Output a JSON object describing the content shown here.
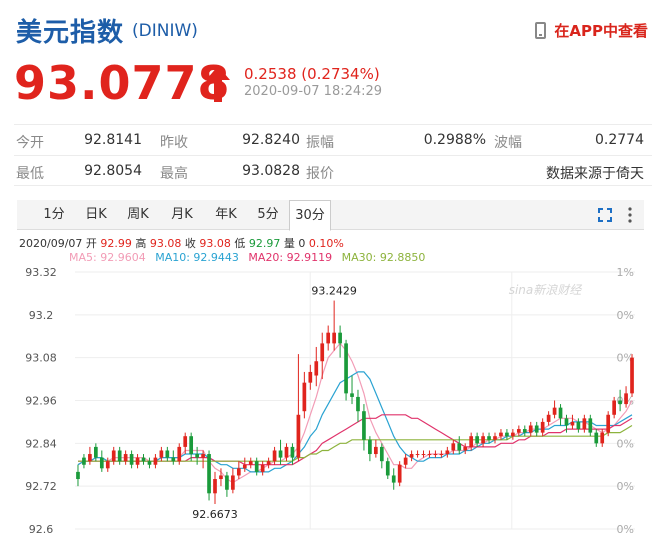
{
  "header": {
    "title": "美元指数",
    "code": "(DINIW)",
    "app_link": "在APP中查看"
  },
  "quote": {
    "price": "93.0778",
    "change": "0.2538 (0.2734%)",
    "timestamp": "2020-09-07 18:24:29"
  },
  "stats": [
    [
      {
        "label": "今开",
        "value": "92.8141"
      },
      {
        "label": "昨收",
        "value": "92.8240"
      },
      {
        "label": "振幅",
        "value": "0.2988%"
      },
      {
        "label": "波幅",
        "value": "0.2774"
      }
    ],
    [
      {
        "label": "最低",
        "value": "92.8054"
      },
      {
        "label": "最高",
        "value": "93.0828"
      },
      {
        "label": "报价",
        "value": "数据来源于倚天"
      }
    ]
  ],
  "tabs": [
    "1分",
    "日K",
    "周K",
    "月K",
    "年K",
    "5分",
    "30分"
  ],
  "active_tab": "30分",
  "info": {
    "date": "2020/09/07",
    "open_label": "开",
    "open": "92.99",
    "high_label": "高",
    "high": "93.08",
    "close_label": "收",
    "close": "93.08",
    "low_label": "低",
    "low": "92.97",
    "volume_label": "量",
    "volume": "0",
    "pct": "0.10%"
  },
  "ma_legend": [
    {
      "label": "MA5: 92.9604",
      "color": "#f29cb6"
    },
    {
      "label": "MA10: 92.9443",
      "color": "#2aa3d2"
    },
    {
      "label": "MA20: 92.9119",
      "color": "#e0336b"
    },
    {
      "label": "MA30: 92.8850",
      "color": "#8db33d"
    }
  ],
  "watermark": "sina新浪财经",
  "colors": {
    "up": "#e0241d",
    "down": "#1a9a3a",
    "accent": "#1d5da8"
  },
  "chart_data": {
    "type": "candlestick",
    "y_ticks": [
      "93.32",
      "93.2",
      "93.08",
      "92.96",
      "92.84",
      "92.72",
      "92.6"
    ],
    "ylim": [
      92.6,
      93.32
    ],
    "pct_ticks": [
      "1%",
      "0%",
      "0%",
      "0%",
      "0%",
      "0%",
      "0%"
    ],
    "grid": true,
    "annotations": [
      {
        "text": "93.2429",
        "index": 43
      },
      {
        "text": "92.6673",
        "index": 23
      }
    ],
    "candles": [
      [
        92.76,
        92.74,
        92.78,
        92.72
      ],
      [
        92.8,
        92.78,
        92.81,
        92.77
      ],
      [
        92.79,
        92.81,
        92.83,
        92.78
      ],
      [
        92.83,
        92.8,
        92.84,
        92.79
      ],
      [
        92.8,
        92.77,
        92.82,
        92.76
      ],
      [
        92.77,
        92.79,
        92.8,
        92.76
      ],
      [
        92.79,
        92.82,
        92.83,
        92.78
      ],
      [
        92.82,
        92.79,
        92.83,
        92.78
      ],
      [
        92.79,
        92.81,
        92.82,
        92.78
      ],
      [
        92.81,
        92.78,
        92.82,
        92.77
      ],
      [
        92.78,
        92.8,
        92.81,
        92.77
      ],
      [
        92.8,
        92.79,
        92.81,
        92.78
      ],
      [
        92.79,
        92.78,
        92.8,
        92.77
      ],
      [
        92.78,
        92.8,
        92.81,
        92.77
      ],
      [
        92.8,
        92.82,
        92.83,
        92.79
      ],
      [
        92.82,
        92.8,
        92.83,
        92.79
      ],
      [
        92.8,
        92.79,
        92.82,
        92.78
      ],
      [
        92.79,
        92.83,
        92.84,
        92.78
      ],
      [
        92.83,
        92.86,
        92.87,
        92.81
      ],
      [
        92.86,
        92.81,
        92.87,
        92.79
      ],
      [
        92.81,
        92.8,
        92.83,
        92.78
      ],
      [
        92.8,
        92.81,
        92.82,
        92.77
      ],
      [
        92.81,
        92.7,
        92.82,
        92.68
      ],
      [
        92.7,
        92.74,
        92.76,
        92.67
      ],
      [
        92.74,
        92.75,
        92.77,
        92.72
      ],
      [
        92.75,
        92.71,
        92.76,
        92.69
      ],
      [
        92.71,
        92.75,
        92.77,
        92.7
      ],
      [
        92.75,
        92.77,
        92.79,
        92.74
      ],
      [
        92.77,
        92.78,
        92.8,
        92.76
      ],
      [
        92.78,
        92.79,
        92.8,
        92.77
      ],
      [
        92.79,
        92.76,
        92.8,
        92.75
      ],
      [
        92.76,
        92.78,
        92.79,
        92.75
      ],
      [
        92.78,
        92.79,
        92.8,
        92.77
      ],
      [
        92.79,
        92.82,
        92.83,
        92.78
      ],
      [
        92.82,
        92.8,
        92.85,
        92.78
      ],
      [
        92.8,
        92.83,
        92.84,
        92.79
      ],
      [
        92.83,
        92.8,
        92.84,
        92.78
      ],
      [
        92.8,
        92.92,
        93.09,
        92.79
      ],
      [
        92.93,
        93.01,
        93.04,
        92.91
      ],
      [
        93.01,
        93.04,
        93.06,
        92.99
      ],
      [
        93.03,
        93.07,
        93.11,
        93.0
      ],
      [
        93.07,
        93.12,
        93.15,
        93.02
      ],
      [
        93.12,
        93.15,
        93.17,
        93.1
      ],
      [
        93.12,
        93.15,
        93.24,
        93.1
      ],
      [
        93.15,
        93.12,
        93.17,
        93.08
      ],
      [
        93.12,
        92.98,
        93.13,
        92.96
      ],
      [
        92.98,
        92.97,
        93.03,
        92.95
      ],
      [
        92.97,
        92.93,
        92.99,
        92.9
      ],
      [
        92.93,
        92.85,
        92.95,
        92.82
      ],
      [
        92.85,
        92.81,
        92.86,
        92.79
      ],
      [
        92.81,
        92.83,
        92.85,
        92.8
      ],
      [
        92.83,
        92.79,
        92.84,
        92.77
      ],
      [
        92.79,
        92.75,
        92.8,
        92.74
      ],
      [
        92.75,
        92.73,
        92.77,
        92.71
      ],
      [
        92.73,
        92.78,
        92.79,
        92.72
      ],
      [
        92.78,
        92.8,
        92.81,
        92.77
      ],
      [
        92.8,
        92.81,
        92.82,
        92.79
      ],
      [
        92.81,
        92.81,
        92.82,
        92.8
      ],
      [
        92.81,
        92.81,
        92.82,
        92.8
      ],
      [
        92.81,
        92.81,
        92.82,
        92.8
      ],
      [
        92.81,
        92.81,
        92.82,
        92.8
      ],
      [
        92.81,
        92.81,
        92.82,
        92.8
      ],
      [
        92.81,
        92.82,
        92.83,
        92.8
      ],
      [
        92.82,
        92.84,
        92.85,
        92.81
      ],
      [
        92.84,
        92.82,
        92.86,
        92.81
      ],
      [
        92.82,
        92.83,
        92.84,
        92.81
      ],
      [
        92.83,
        92.86,
        92.87,
        92.82
      ],
      [
        92.86,
        92.84,
        92.87,
        92.83
      ],
      [
        92.84,
        92.86,
        92.87,
        92.83
      ],
      [
        92.86,
        92.85,
        92.87,
        92.84
      ],
      [
        92.85,
        92.86,
        92.87,
        92.84
      ],
      [
        92.86,
        92.87,
        92.88,
        92.85
      ],
      [
        92.87,
        92.86,
        92.88,
        92.85
      ],
      [
        92.86,
        92.87,
        92.88,
        92.85
      ],
      [
        92.87,
        92.88,
        92.89,
        92.86
      ],
      [
        92.88,
        92.87,
        92.89,
        92.86
      ],
      [
        92.87,
        92.89,
        92.9,
        92.86
      ],
      [
        92.89,
        92.87,
        92.9,
        92.86
      ],
      [
        92.87,
        92.9,
        92.91,
        92.86
      ],
      [
        92.9,
        92.92,
        92.93,
        92.89
      ],
      [
        92.92,
        92.94,
        92.96,
        92.91
      ],
      [
        92.94,
        92.91,
        92.95,
        92.89
      ],
      [
        92.91,
        92.89,
        92.92,
        92.87
      ],
      [
        92.89,
        92.9,
        92.92,
        92.88
      ],
      [
        92.9,
        92.88,
        92.91,
        92.87
      ],
      [
        92.88,
        92.91,
        92.92,
        92.87
      ],
      [
        92.91,
        92.87,
        92.92,
        92.86
      ],
      [
        92.87,
        92.84,
        92.88,
        92.83
      ],
      [
        92.84,
        92.87,
        92.88,
        92.83
      ],
      [
        92.87,
        92.92,
        92.93,
        92.86
      ],
      [
        92.92,
        92.96,
        92.97,
        92.91
      ],
      [
        92.96,
        92.95,
        92.99,
        92.93
      ],
      [
        92.95,
        92.98,
        93.0,
        92.94
      ],
      [
        92.98,
        93.08,
        93.09,
        92.97
      ]
    ],
    "series": [
      {
        "name": "MA5",
        "color": "#f29cb6",
        "values": [
          92.78,
          92.79,
          92.79,
          92.8,
          92.8,
          92.79,
          92.8,
          92.8,
          92.8,
          92.8,
          92.8,
          92.8,
          92.79,
          92.79,
          92.8,
          92.8,
          92.8,
          92.8,
          92.82,
          92.82,
          92.82,
          92.82,
          92.79,
          92.77,
          92.76,
          92.74,
          92.73,
          92.74,
          92.75,
          92.76,
          92.76,
          92.77,
          92.78,
          92.79,
          92.79,
          92.8,
          92.81,
          92.83,
          92.87,
          92.92,
          92.97,
          93.03,
          93.08,
          93.1,
          93.12,
          93.1,
          93.07,
          93.03,
          92.98,
          92.91,
          92.87,
          92.84,
          92.81,
          92.78,
          92.78,
          92.77,
          92.77,
          92.79,
          92.8,
          92.81,
          92.81,
          92.81,
          92.81,
          92.82,
          92.82,
          92.82,
          92.83,
          92.84,
          92.84,
          92.85,
          92.85,
          92.86,
          92.86,
          92.86,
          92.87,
          92.87,
          92.88,
          92.88,
          92.88,
          92.89,
          92.9,
          92.91,
          92.91,
          92.91,
          92.9,
          92.9,
          92.89,
          92.88,
          92.87,
          92.88,
          92.89,
          92.91,
          92.93,
          92.96
        ]
      },
      {
        "name": "MA10",
        "color": "#2aa3d2",
        "values": [
          92.78,
          92.79,
          92.79,
          92.8,
          92.8,
          92.79,
          92.79,
          92.79,
          92.79,
          92.79,
          92.79,
          92.79,
          92.79,
          92.79,
          92.8,
          92.8,
          92.8,
          92.8,
          92.81,
          92.81,
          92.81,
          92.81,
          92.8,
          92.79,
          92.78,
          92.78,
          92.77,
          92.77,
          92.77,
          92.76,
          92.76,
          92.76,
          92.76,
          92.77,
          92.77,
          92.78,
          92.79,
          92.81,
          92.83,
          92.86,
          92.88,
          92.92,
          92.95,
          92.98,
          93.01,
          93.02,
          93.03,
          93.04,
          93.04,
          93.02,
          92.98,
          92.94,
          92.9,
          92.86,
          92.83,
          92.81,
          92.8,
          92.79,
          92.79,
          92.8,
          92.8,
          92.8,
          92.81,
          92.81,
          92.81,
          92.82,
          92.82,
          92.83,
          92.84,
          92.84,
          92.85,
          92.85,
          92.86,
          92.86,
          92.86,
          92.87,
          92.87,
          92.88,
          92.88,
          92.88,
          92.89,
          92.89,
          92.89,
          92.9,
          92.9,
          92.9,
          92.9,
          92.89,
          92.89,
          92.89,
          92.89,
          92.9,
          92.91,
          92.92
        ]
      },
      {
        "name": "MA20",
        "color": "#e0336b",
        "values": [
          92.79,
          92.79,
          92.79,
          92.79,
          92.79,
          92.79,
          92.79,
          92.79,
          92.79,
          92.79,
          92.79,
          92.79,
          92.79,
          92.79,
          92.79,
          92.79,
          92.79,
          92.79,
          92.79,
          92.8,
          92.8,
          92.8,
          92.8,
          92.79,
          92.79,
          92.79,
          92.79,
          92.79,
          92.78,
          92.78,
          92.78,
          92.78,
          92.78,
          92.78,
          92.78,
          92.78,
          92.78,
          92.79,
          92.8,
          92.81,
          92.82,
          92.84,
          92.85,
          92.86,
          92.87,
          92.88,
          92.89,
          92.9,
          92.91,
          92.91,
          92.91,
          92.92,
          92.92,
          92.92,
          92.92,
          92.92,
          92.91,
          92.91,
          92.9,
          92.89,
          92.88,
          92.87,
          92.86,
          92.85,
          92.84,
          92.83,
          92.83,
          92.83,
          92.83,
          92.83,
          92.83,
          92.84,
          92.84,
          92.84,
          92.85,
          92.85,
          92.86,
          92.86,
          92.86,
          92.87,
          92.87,
          92.87,
          92.88,
          92.88,
          92.88,
          92.88,
          92.88,
          92.88,
          92.88,
          92.88,
          92.89,
          92.89,
          92.9,
          92.91
        ]
      },
      {
        "name": "MA30",
        "color": "#8db33d",
        "values": [
          92.79,
          92.79,
          92.79,
          92.79,
          92.79,
          92.79,
          92.79,
          92.79,
          92.79,
          92.79,
          92.79,
          92.79,
          92.79,
          92.79,
          92.79,
          92.79,
          92.79,
          92.79,
          92.79,
          92.79,
          92.79,
          92.79,
          92.79,
          92.79,
          92.79,
          92.79,
          92.79,
          92.79,
          92.79,
          92.79,
          92.79,
          92.79,
          92.79,
          92.79,
          92.79,
          92.79,
          92.79,
          92.8,
          92.8,
          92.81,
          92.81,
          92.82,
          92.82,
          92.83,
          92.84,
          92.84,
          92.85,
          92.85,
          92.85,
          92.85,
          92.85,
          92.85,
          92.85,
          92.85,
          92.85,
          92.85,
          92.85,
          92.85,
          92.85,
          92.85,
          92.85,
          92.85,
          92.85,
          92.85,
          92.85,
          92.85,
          92.85,
          92.85,
          92.85,
          92.85,
          92.85,
          92.85,
          92.85,
          92.86,
          92.86,
          92.86,
          92.86,
          92.86,
          92.86,
          92.86,
          92.86,
          92.86,
          92.86,
          92.86,
          92.86,
          92.86,
          92.86,
          92.86,
          92.86,
          92.87,
          92.87,
          92.87,
          92.88,
          92.89
        ]
      }
    ]
  }
}
